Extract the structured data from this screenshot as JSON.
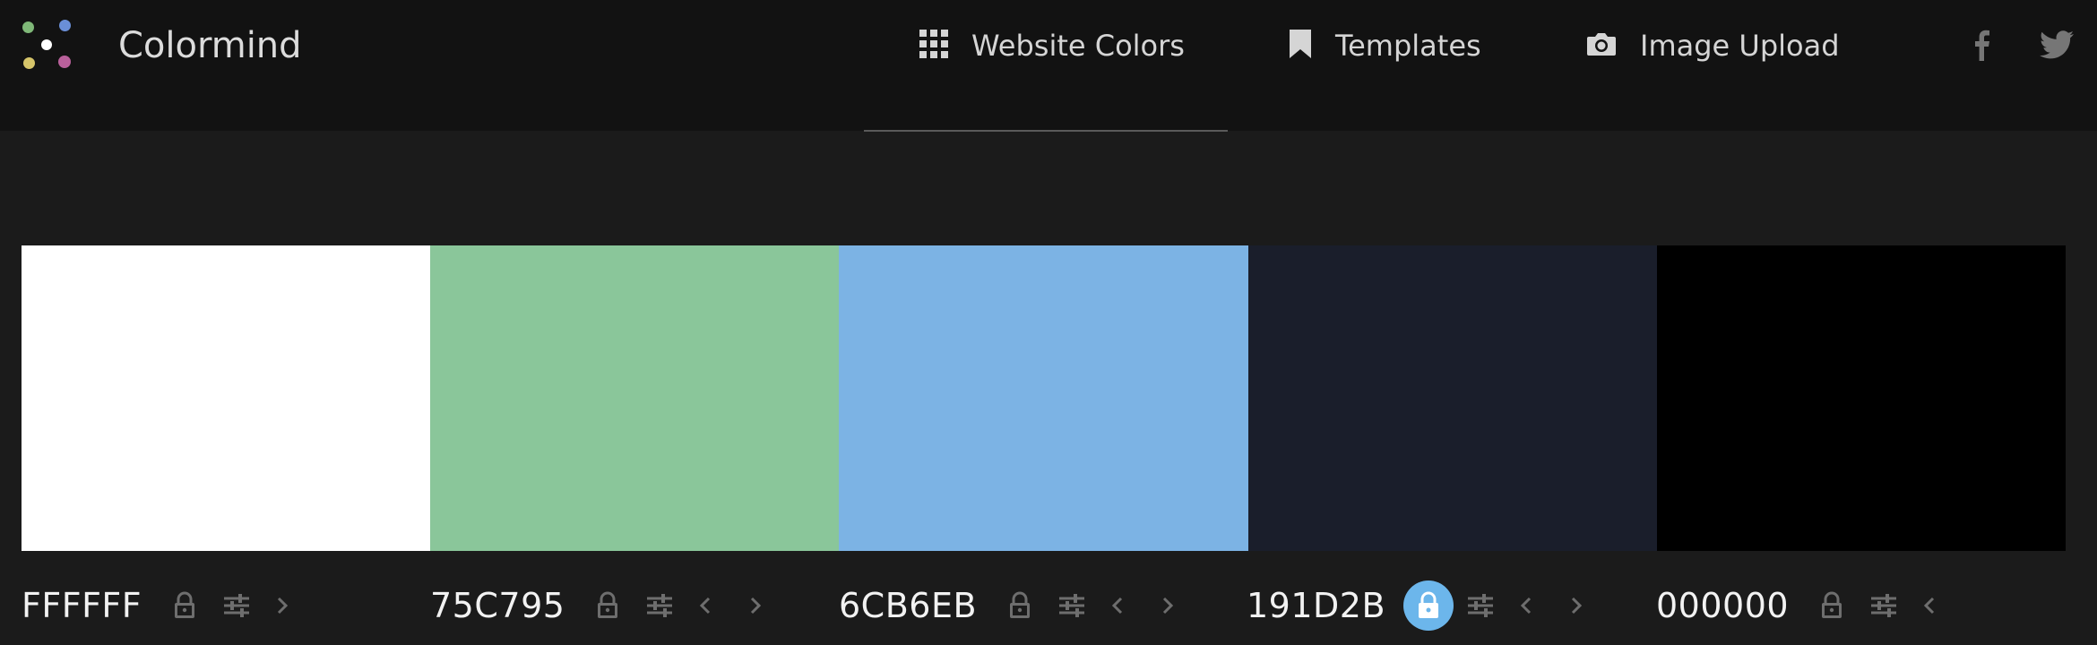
{
  "header": {
    "brand": "Colormind",
    "nav": [
      {
        "label": "Website Colors",
        "icon": "grid-icon"
      },
      {
        "label": "Templates",
        "icon": "bookmark-icon"
      },
      {
        "label": "Image Upload",
        "icon": "camera-icon"
      }
    ],
    "social": [
      {
        "icon": "facebook-icon"
      },
      {
        "icon": "twitter-icon"
      }
    ]
  },
  "palette": {
    "swatches": [
      {
        "hex": "FFFFFF",
        "color": "#FFFFFF",
        "locked": false,
        "controls": [
          "lock-icon",
          "sliders-icon",
          "chevron-right-icon"
        ]
      },
      {
        "hex": "75C795",
        "color": "#8AC69A",
        "locked": false,
        "controls": [
          "lock-icon",
          "sliders-icon",
          "chevron-left-icon",
          "chevron-right-icon"
        ]
      },
      {
        "hex": "6CB6EB",
        "color": "#7CB3E4",
        "locked": false,
        "controls": [
          "lock-icon",
          "sliders-icon",
          "chevron-left-icon",
          "chevron-right-icon"
        ]
      },
      {
        "hex": "191D2B",
        "color": "#1A1E2B",
        "locked": true,
        "controls": [
          "lock-icon",
          "sliders-icon",
          "chevron-left-icon",
          "chevron-right-icon"
        ]
      },
      {
        "hex": "000000",
        "color": "#000000",
        "locked": false,
        "controls": [
          "lock-icon",
          "sliders-icon",
          "chevron-left-icon"
        ]
      }
    ]
  },
  "colors": {
    "header_bg": "#121212",
    "page_bg": "#1B1B1B",
    "icon_muted": "#6E6E6E",
    "lock_active": "#6CB6EB"
  }
}
